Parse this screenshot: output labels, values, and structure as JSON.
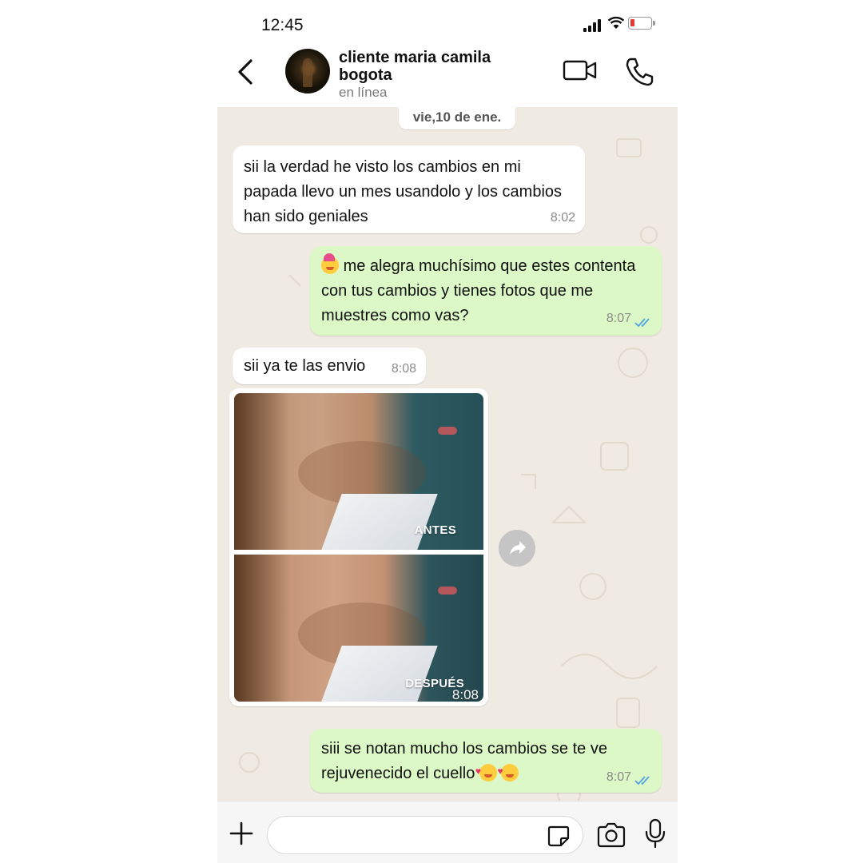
{
  "status_bar": {
    "time": "12:45"
  },
  "header": {
    "contact_name": "cliente maria camila bogota",
    "presence": "en línea"
  },
  "chat": {
    "date_separator": "vie,10 de ene.",
    "messages": [
      {
        "direction": "incoming",
        "text": "sii la verdad he visto los cambios en mi papada llevo un mes usandolo y los cambios han sido geniales",
        "time": "8:02"
      },
      {
        "direction": "outgoing",
        "emoji": "partying-face",
        "text": "me alegra muchísimo que estes contenta con tus cambios y tienes fotos que me muestres como vas?",
        "time": "8:07",
        "status": "read"
      },
      {
        "direction": "incoming",
        "text": "sii ya te las envio",
        "time": "8:08"
      },
      {
        "direction": "incoming",
        "type": "image",
        "labels": [
          "ANTES",
          "DESPUÉS"
        ],
        "time": "8:08"
      },
      {
        "direction": "outgoing",
        "text": "siii se notan mucho los cambios se te ve rejuvenecido el cuello",
        "emoji": "smiling-face-with-hearts",
        "time": "8:07",
        "status": "read"
      }
    ]
  },
  "input": {
    "placeholder": ""
  },
  "colors": {
    "incoming_bubble": "#ffffff",
    "outgoing_bubble": "#dcf8c6",
    "chat_background": "#efeae2",
    "read_ticks": "#4fa3e0"
  }
}
